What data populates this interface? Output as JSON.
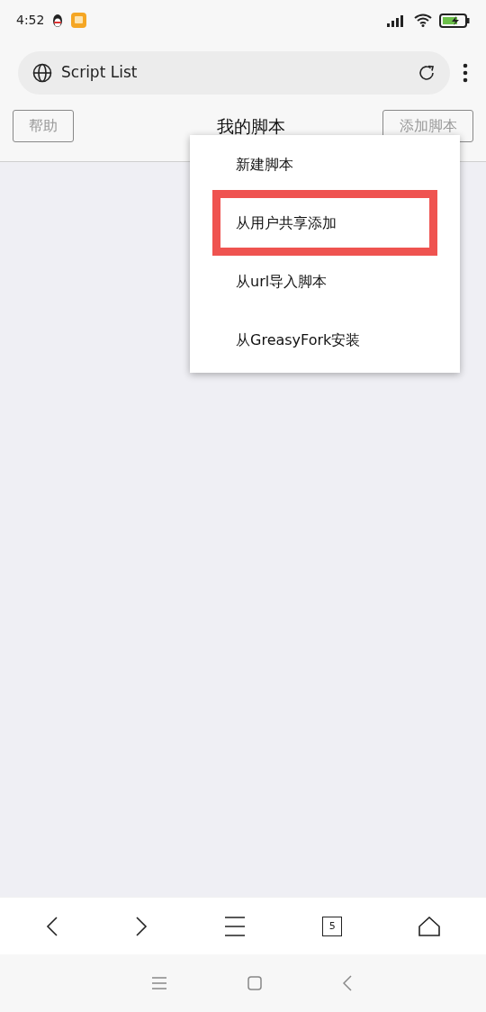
{
  "status_bar": {
    "time": "4:52"
  },
  "address_bar": {
    "title": "Script List"
  },
  "header": {
    "help_button": "帮助",
    "title": "我的脚本",
    "add_button": "添加脚本"
  },
  "menu": {
    "items": [
      {
        "label": "新建脚本",
        "highlighted": false
      },
      {
        "label": "从用户共享添加",
        "highlighted": true
      },
      {
        "label": "从url导入脚本",
        "highlighted": false
      },
      {
        "label": "从GreasyFork安装",
        "highlighted": false
      }
    ]
  },
  "bottom_nav": {
    "tab_count": "5"
  }
}
